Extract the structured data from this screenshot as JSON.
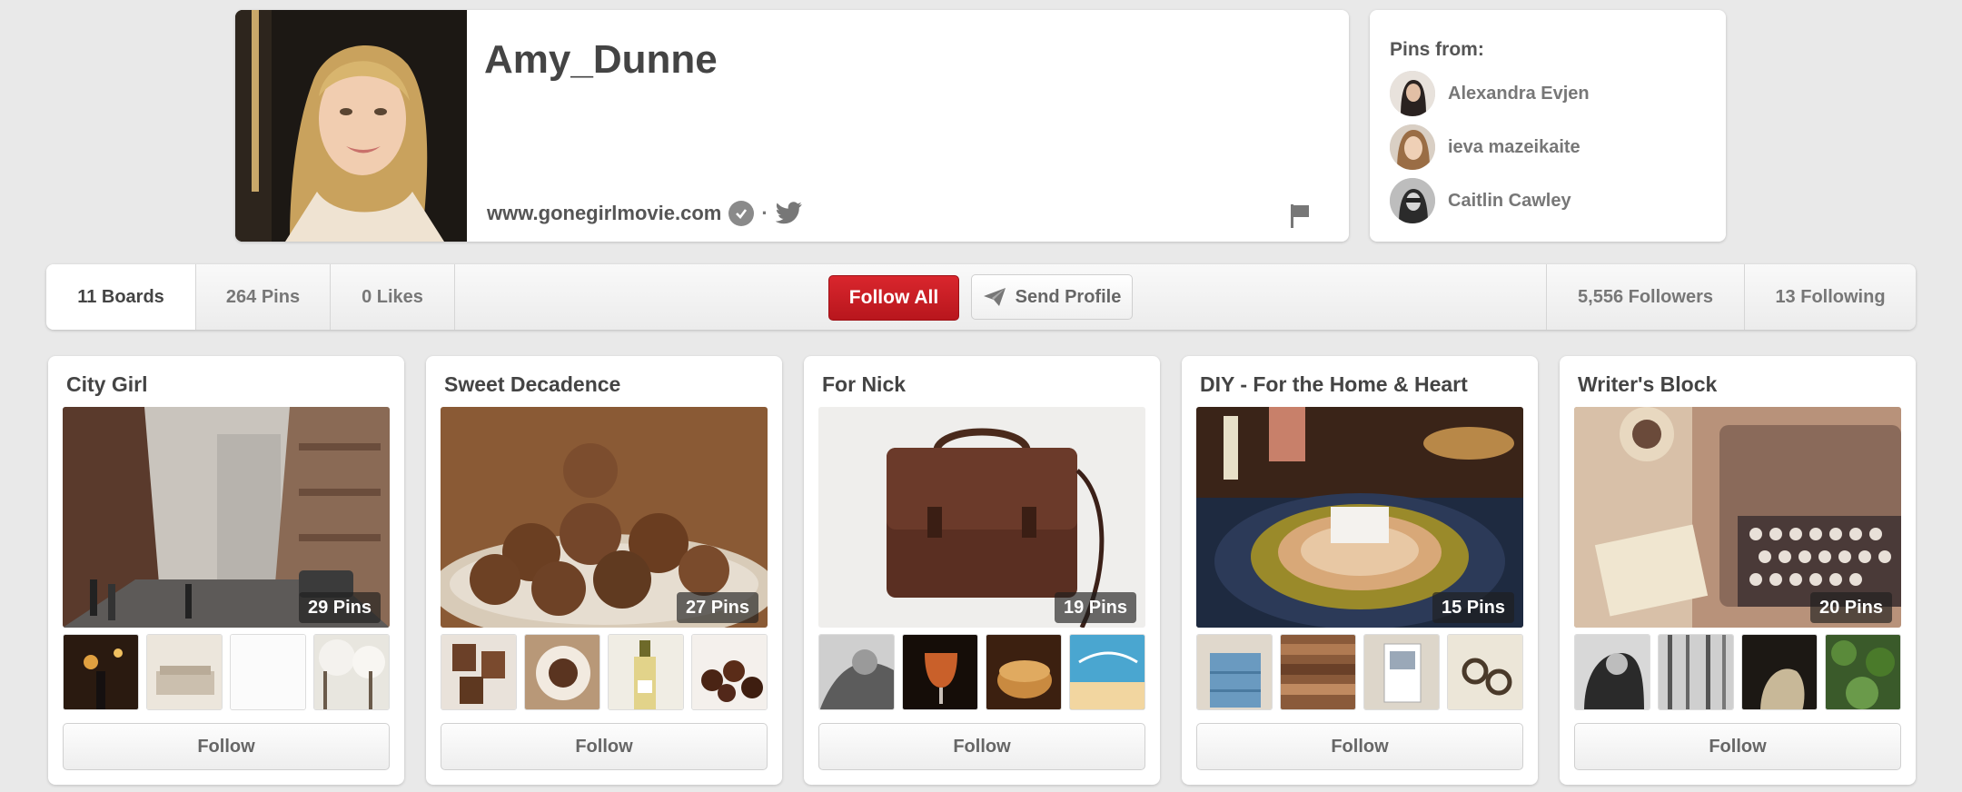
{
  "profile": {
    "name": "Amy_Dunne",
    "website": "www.gonegirlmovie.com",
    "separator": "·"
  },
  "pins_from": {
    "title": "Pins from:",
    "users": [
      {
        "name": "Alexandra Evjen"
      },
      {
        "name": "ieva mazeikaite"
      },
      {
        "name": "Caitlin Cawley"
      }
    ]
  },
  "stats": {
    "boards": "11 Boards",
    "pins": "264 Pins",
    "likes": "0 Likes",
    "followers": "5,556 Followers",
    "following": "13 Following"
  },
  "actions": {
    "follow_all": "Follow All",
    "send_profile": "Send Profile"
  },
  "boards": [
    {
      "title": "City Girl",
      "pins": "29 Pins",
      "follow": "Follow"
    },
    {
      "title": "Sweet Decadence",
      "pins": "27 Pins",
      "follow": "Follow"
    },
    {
      "title": "For Nick",
      "pins": "19 Pins",
      "follow": "Follow"
    },
    {
      "title": "DIY - For the Home & Heart",
      "pins": "15 Pins",
      "follow": "Follow"
    },
    {
      "title": "Writer's Block",
      "pins": "20 Pins",
      "follow": "Follow"
    }
  ],
  "colors": {
    "accent_red": "#c91d24",
    "background": "#e9e9e9"
  }
}
